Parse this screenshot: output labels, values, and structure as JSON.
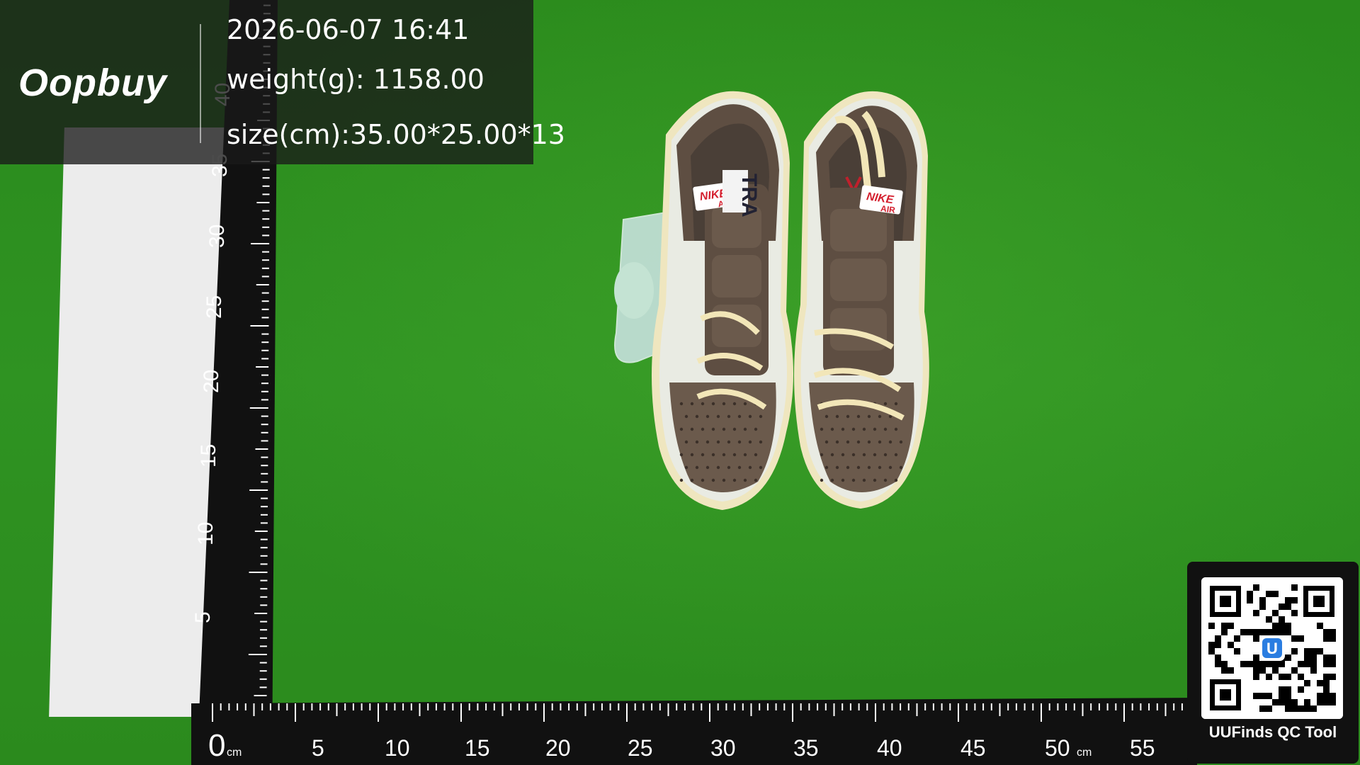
{
  "overlay": {
    "brand": "Oopbuy",
    "timestamp": "2026-06-07 16:41",
    "weight": "weight(g): 1158.00",
    "size": "size(cm):35.00*25.00*13"
  },
  "ruler_vertical": {
    "labels": [
      "40",
      "35",
      "30",
      "25",
      "20",
      "15",
      "10",
      "5"
    ]
  },
  "ruler_horizontal": {
    "zero": "0",
    "unit": "cm",
    "labels": [
      "5",
      "10",
      "15",
      "20",
      "25",
      "30",
      "35",
      "40",
      "45",
      "50",
      "55"
    ]
  },
  "shoe_labels": {
    "left_tongue_brand": "NIKE",
    "left_tongue_sub": "AIR",
    "right_tongue_brand": "NIKE",
    "right_tongue_sub": "AIR",
    "insole_text": "TRA"
  },
  "qr_panel": {
    "label": "UUFinds QC Tool",
    "center_letter": "U"
  },
  "colors": {
    "mat": "#2f8f1f",
    "suede": "#6b5a4c",
    "leather": "#e9ebe3",
    "sole": "#efe6bf",
    "nike_red": "#d41f2e"
  }
}
